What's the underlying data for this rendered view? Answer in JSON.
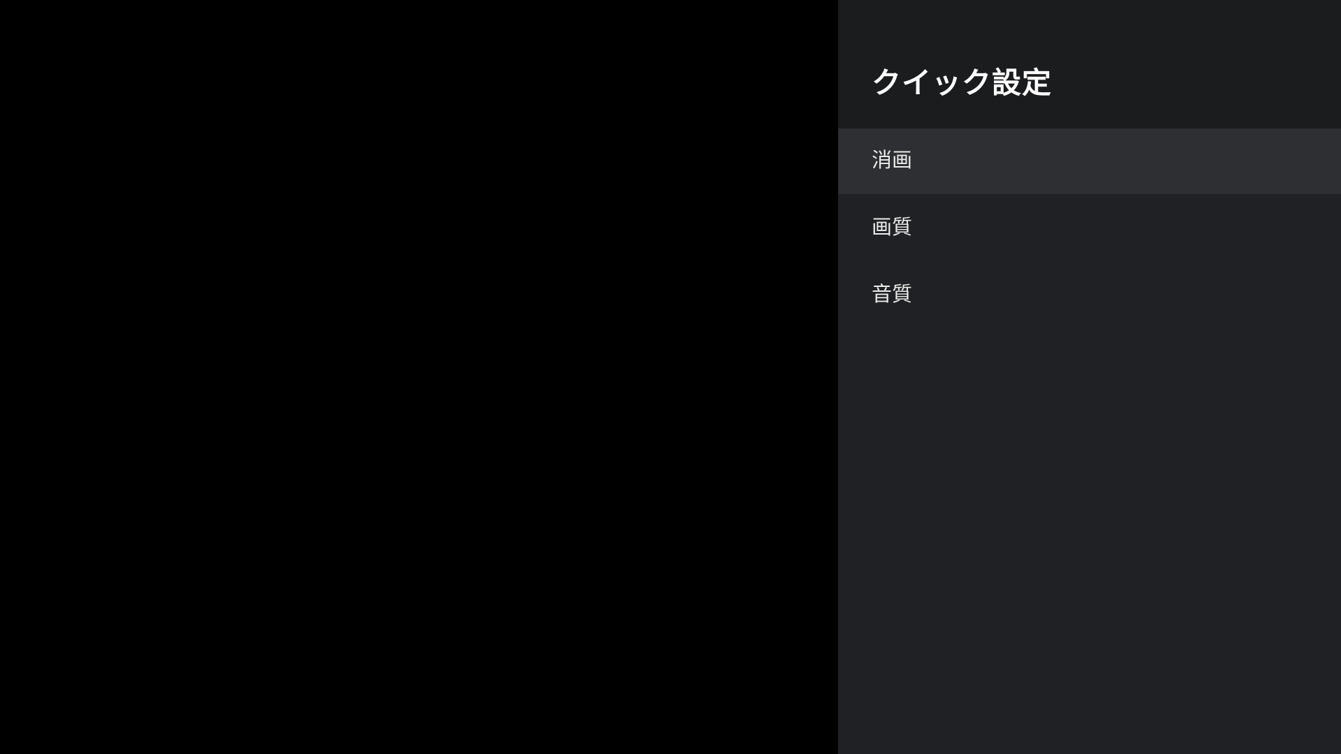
{
  "quick_settings": {
    "title": "クイック設定",
    "items": [
      {
        "label": "消画",
        "focused": true
      },
      {
        "label": "画質",
        "focused": false
      },
      {
        "label": "音質",
        "focused": false
      }
    ]
  },
  "colors": {
    "background": "#000000",
    "panel": "#202124",
    "panel_header": "#1b1c1e",
    "focused_item": "#2e2f32",
    "text": "#ffffff"
  }
}
